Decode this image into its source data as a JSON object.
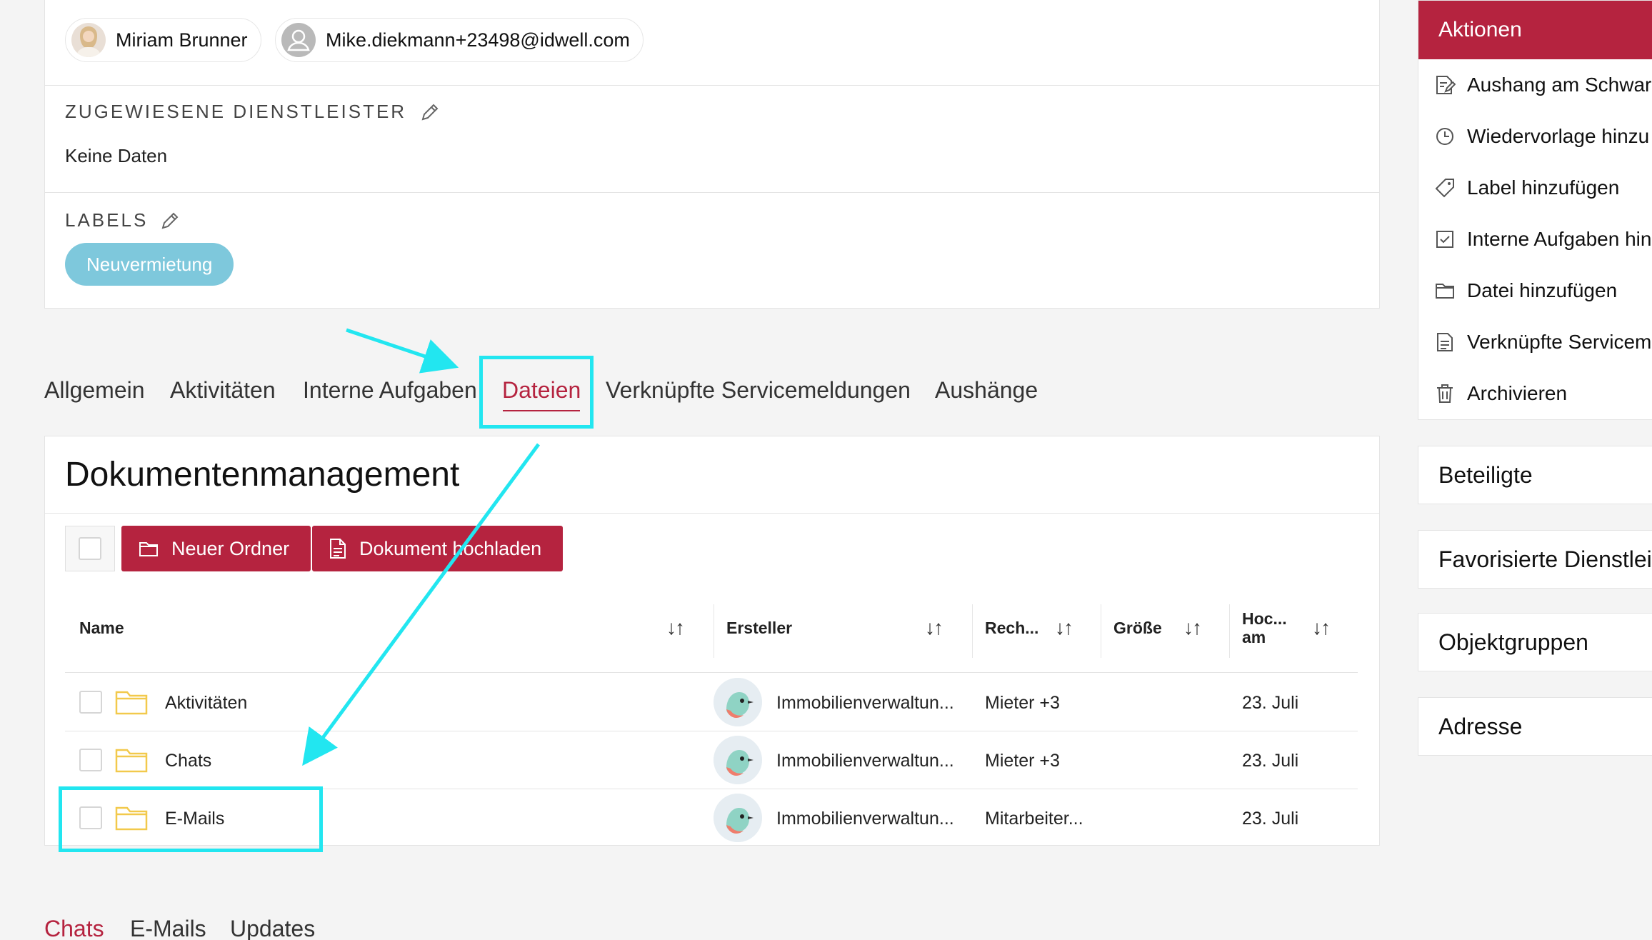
{
  "top_card": {
    "people": [
      {
        "name": "Miriam Brunner"
      },
      {
        "name": "Mike.diekmann+23498@idwell.com"
      }
    ],
    "service_providers": {
      "title": "Zugewiesene Dienstleister",
      "empty_text": "Keine Daten"
    },
    "labels": {
      "title": "Labels",
      "badge": "Neuvermietung"
    }
  },
  "tabs": [
    "Allgemein",
    "Aktivitäten",
    "Interne Aufgaben",
    "Dateien",
    "Verknüpfte Servicemeldungen",
    "Aushänge"
  ],
  "active_tab": "Dateien",
  "docs": {
    "title": "Dokumentenmanagement",
    "new_folder": "Neuer Ordner",
    "upload": "Dokument hochladen",
    "columns": [
      "Name",
      "Ersteller",
      "Rech...",
      "Größe",
      "Hoc...\nam"
    ],
    "sort_glyph": "↓↑",
    "rows": [
      {
        "name": "Aktivitäten",
        "creator": "Immobilienverwaltun...",
        "rights": "Mieter +3",
        "size": "",
        "date": "23. Juli"
      },
      {
        "name": "Chats",
        "creator": "Immobilienverwaltun...",
        "rights": "Mieter +3",
        "size": "",
        "date": "23. Juli"
      },
      {
        "name": "E-Mails",
        "creator": "Immobilienverwaltun...",
        "rights": "Mitarbeiter...",
        "size": "",
        "date": "23. Juli"
      }
    ]
  },
  "bottom_tabs": [
    "Chats",
    "E-Mails",
    "Updates"
  ],
  "actions": {
    "title": "Aktionen",
    "items": [
      "Aushang am Schwar",
      "Wiedervorlage hinzu",
      "Label hinzufügen",
      "Interne Aufgaben hin",
      "Datei hinzufügen",
      "Verknüpfte Servicem",
      "Archivieren"
    ]
  },
  "side_sections": [
    "Beteiligte",
    "Favorisierte Dienstlei",
    "Objektgruppen",
    "Adresse"
  ],
  "colors": {
    "brand": "#b5233f",
    "label": "#7ec8dc",
    "folder": "#f2c94c",
    "annotation": "#22e6f0"
  }
}
